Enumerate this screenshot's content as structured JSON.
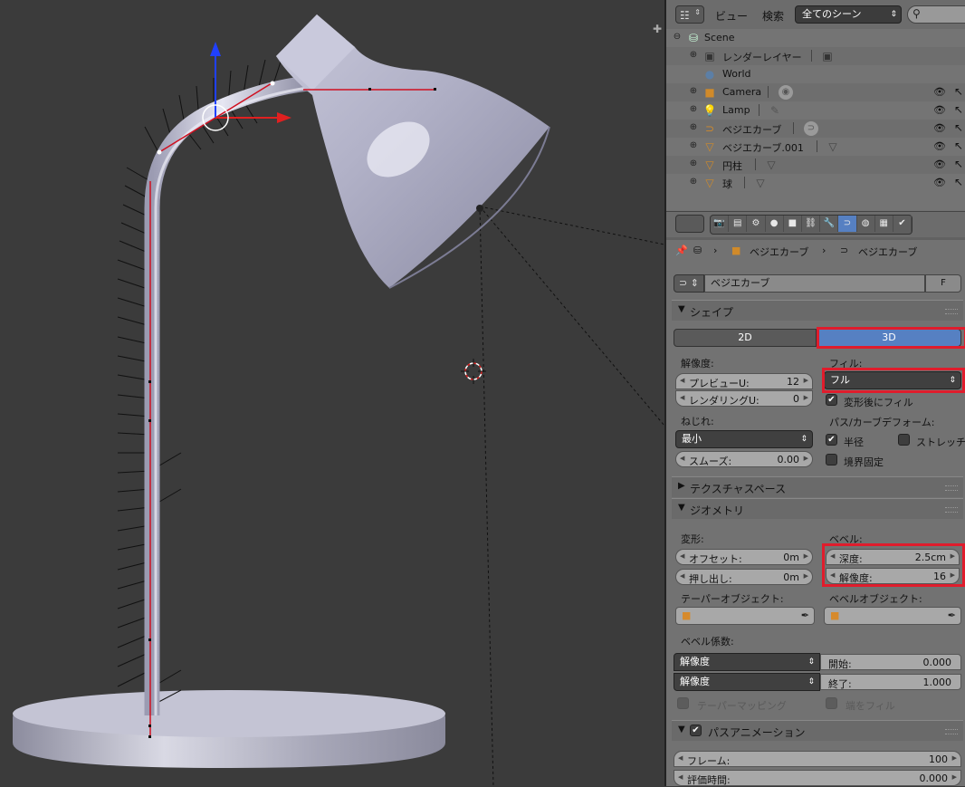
{
  "outliner": {
    "menu_view": "ビュー",
    "menu_search": "検索",
    "scene_select": "全てのシーン",
    "rows": [
      {
        "label": "Scene"
      },
      {
        "label": "レンダーレイヤー"
      },
      {
        "label": "World"
      },
      {
        "label": "Camera"
      },
      {
        "label": "Lamp"
      },
      {
        "label": "ベジエカーブ"
      },
      {
        "label": "ベジエカーブ.001"
      },
      {
        "label": "円柱"
      },
      {
        "label": "球"
      }
    ]
  },
  "properties": {
    "breadcrumb": [
      "ベジエカーブ",
      "ベジエカーブ"
    ],
    "datablock_name": "ベジエカーブ",
    "fake_user": "F",
    "shape": {
      "title": "シェイプ",
      "btn_2d": "2D",
      "btn_3d": "3D",
      "resolution_label": "解像度:",
      "preview_u": {
        "label": "プレビューU:",
        "value": "12"
      },
      "render_u": {
        "label": "レンダリングU:",
        "value": "0"
      },
      "fill_label": "フィル:",
      "fill_value": "フル",
      "fill_deformed": "変形後にフィル",
      "twist_label": "ねじれ:",
      "twist_value": "最小",
      "smooth": {
        "label": "スムーズ:",
        "value": "0.00"
      },
      "path_deform_label": "パス/カーブデフォーム:",
      "radius": "半径",
      "stretch": "ストレッチ",
      "bounds_clamp": "境界固定"
    },
    "texture_space": {
      "title": "テクスチャスペース"
    },
    "geometry": {
      "title": "ジオメトリ",
      "modification_label": "変形:",
      "offset": {
        "label": "オフセット:",
        "value": "0m"
      },
      "extrude": {
        "label": "押し出し:",
        "value": "0m"
      },
      "bevel_label": "ベベル:",
      "depth": {
        "label": "深度:",
        "value": "2.5cm"
      },
      "bevel_resolution": {
        "label": "解像度:",
        "value": "16"
      },
      "taper_object_label": "テーパーオブジェクト:",
      "bevel_object_label": "ベベルオブジェクト:",
      "bevel_factor_label": "ベベル係数:",
      "factor_mode1": "解像度",
      "factor_mode2": "解像度",
      "start": {
        "label": "開始:",
        "value": "0.000"
      },
      "end": {
        "label": "終了:",
        "value": "1.000"
      },
      "taper_mapping": "テーパーマッピング",
      "fill_caps": "端をフィル"
    },
    "path_animation": {
      "title": "パスアニメーション",
      "frames": {
        "label": "フレーム:",
        "value": "100"
      },
      "eval_time": {
        "label": "評価時間:",
        "value": "0.000"
      }
    }
  },
  "colors": {
    "highlight": "#e01c2c",
    "active_tab": "#5680c2",
    "viewport_bg": "#3b3b3b"
  }
}
